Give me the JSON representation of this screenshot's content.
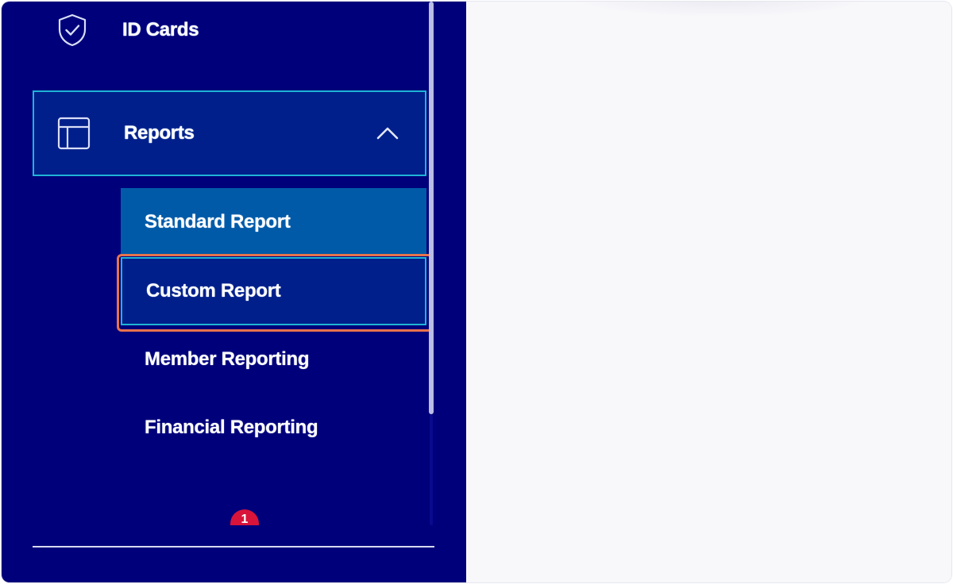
{
  "sidebar": {
    "items": [
      {
        "label": "ID Cards",
        "icon": "shield-check-icon"
      },
      {
        "label": "Reports",
        "icon": "layout-table-icon",
        "expanded": true,
        "chevron": "chevron-up-icon"
      }
    ],
    "reports_sub_items": [
      {
        "label": "Standard Report"
      },
      {
        "label": "Custom Report",
        "selected": true
      },
      {
        "label": "Member Reporting"
      },
      {
        "label": "Financial Reporting"
      }
    ],
    "notification_badge": "1"
  },
  "colors": {
    "sidebar_bg": "#00007a",
    "active_bg": "#001f8a",
    "hover_bg": "#005aa8",
    "focus_border": "#1fb4d6",
    "highlight": "#e8734d",
    "badge": "#d8143a",
    "content_bg": "#f8f8fb"
  }
}
